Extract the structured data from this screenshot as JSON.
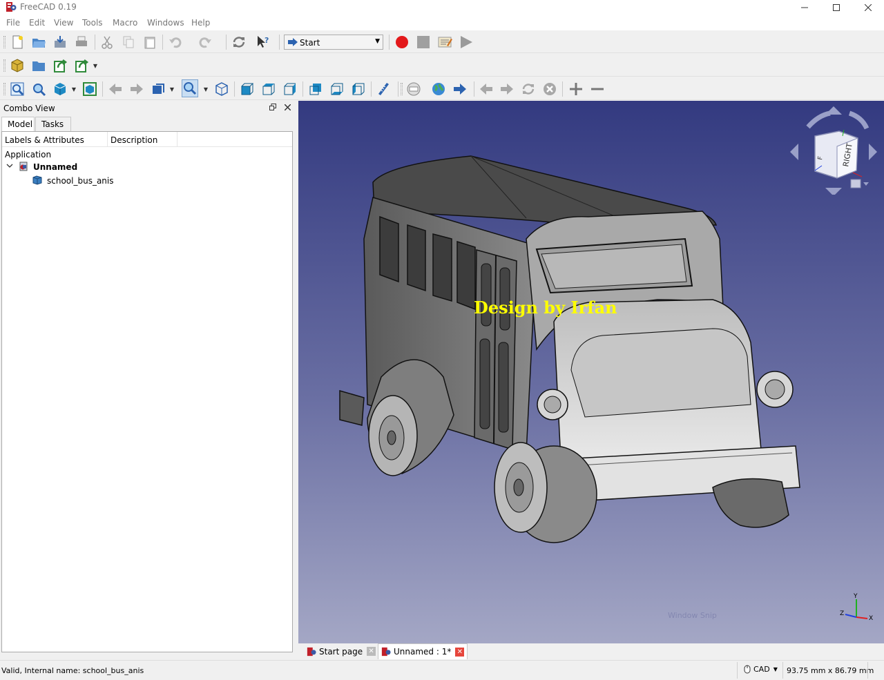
{
  "window": {
    "title": "FreeCAD 0.19"
  },
  "menu": [
    "File",
    "Edit",
    "View",
    "Tools",
    "Macro",
    "Windows",
    "Help"
  ],
  "workbench_selector": {
    "value": "Start"
  },
  "combo_view": {
    "title": "Combo View",
    "tabs": [
      "Model",
      "Tasks"
    ],
    "columns": [
      "Labels & Attributes",
      "Description"
    ],
    "section_label": "Application",
    "document": "Unnamed",
    "object": "school_bus_anis"
  },
  "viewport": {
    "watermark": "Design by Irfan",
    "navcube_face": "RIGHT",
    "snip_text": "Window Snip"
  },
  "doc_tabs": [
    "Start page",
    "Unnamed : 1*"
  ],
  "status": {
    "message": "Valid, Internal name: school_bus_anis",
    "nav_style": "CAD",
    "dimensions": "93.75 mm x 86.79 mm"
  },
  "colors": {
    "record": "#e3191b",
    "close_tab": "#e6463c",
    "axis_x": "#e02020",
    "axis_y": "#20b020",
    "axis_z": "#2040e0"
  }
}
